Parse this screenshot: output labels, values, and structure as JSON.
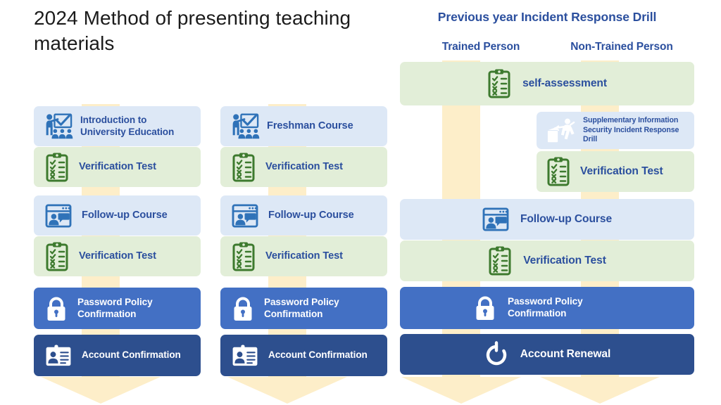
{
  "title": "2024 Method of presenting teaching materials",
  "right_panel": {
    "heading": "Previous year Incident Response Drill",
    "columns": [
      {
        "label": "Trained  Person"
      },
      {
        "label": "Non-Trained  Person"
      }
    ]
  },
  "colors": {
    "accent_navy": "#2b4f9e",
    "box_blue_light": "#dde8f6",
    "box_green_light": "#e2eed8",
    "box_blue_mid": "#4370c4",
    "box_blue_dark": "#2d4f8e",
    "flow_beige": "#fdeec9",
    "icon_blue": "#2f72b8",
    "icon_green": "#3d7a2e",
    "title_text": "#1b1b1b"
  },
  "columns": {
    "col1": {
      "steps": [
        {
          "label": "Introduction to University Education",
          "icon": "teacher-presentation-icon",
          "style": "blue-light"
        },
        {
          "label": "Verification Test",
          "icon": "clipboard-checklist-icon",
          "style": "green-light"
        },
        {
          "label": "Follow-up Course",
          "icon": "video-conference-icon",
          "style": "blue-light"
        },
        {
          "label": "Verification Test",
          "icon": "clipboard-checklist-icon",
          "style": "green-light"
        },
        {
          "label": "Password Policy Confirmation",
          "icon": "padlock-icon",
          "style": "blue-mid"
        },
        {
          "label": "Account Confirmation",
          "icon": "id-card-icon",
          "style": "blue-dark"
        }
      ]
    },
    "col2": {
      "steps": [
        {
          "label": "Freshman Course",
          "icon": "teacher-presentation-icon",
          "style": "blue-light"
        },
        {
          "label": "Verification Test",
          "icon": "clipboard-checklist-icon",
          "style": "green-light"
        },
        {
          "label": "Follow-up Course",
          "icon": "video-conference-icon",
          "style": "blue-light"
        },
        {
          "label": "Verification Test",
          "icon": "clipboard-checklist-icon",
          "style": "green-light"
        },
        {
          "label": "Password Policy Confirmation",
          "icon": "padlock-icon",
          "style": "blue-mid"
        },
        {
          "label": "Account Confirmation",
          "icon": "id-card-icon",
          "style": "blue-dark"
        }
      ]
    },
    "col3": {
      "steps": [
        {
          "label": "self-assessment",
          "icon": "clipboard-checklist-icon",
          "style": "green-light"
        },
        {
          "label": "Supplementary Information Security Incident Response Drill",
          "icon": "fire-drill-person-icon",
          "style": "blue-light"
        },
        {
          "label": "Verification Test",
          "icon": "clipboard-checklist-icon",
          "style": "green-light"
        },
        {
          "label": "Follow-up Course",
          "icon": "video-conference-icon",
          "style": "blue-light"
        },
        {
          "label": "Verification Test",
          "icon": "clipboard-checklist-icon",
          "style": "green-light"
        },
        {
          "label": "Password Policy Confirmation",
          "icon": "padlock-icon",
          "style": "blue-mid"
        },
        {
          "label": "Account Renewal",
          "icon": "refresh-circle-icon",
          "style": "blue-dark"
        }
      ]
    }
  }
}
